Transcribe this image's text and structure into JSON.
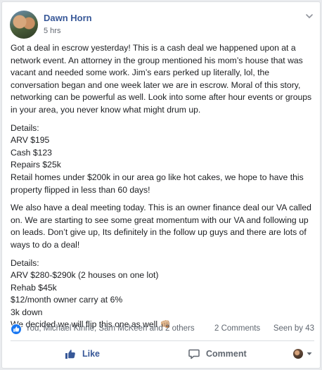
{
  "post": {
    "author": "Dawn Horn",
    "timestamp": "5 hrs",
    "options_icon": "chevron-down-icon",
    "body": {
      "p1": "Got a deal in escrow yesterday! This is a cash deal we happened upon at a network event. An attorney in the group mentioned his mom’s house that was vacant and needed some work. Jim’s ears perked up literally, lol, the conversation began and one week later we are in escrow. Moral of this story, networking can be powerful as well. Look into some after hour events or groups in your area, you never know what might drum up.",
      "d1_heading": "Details:",
      "d1_arv": "ARV $195",
      "d1_cash": "Cash $123",
      "d1_repairs": "Repairs $25k",
      "d1_note": "Retail homes under $200k in our area go like hot cakes, we hope to have this property flipped in less than 60 days!",
      "p2": "We also have a deal meeting today. This is an owner finance deal our VA called on. We are starting to see some great momentum with our VA and following up on leads. Don’t give up, Its definitely in the follow up guys and there are lots of ways to do a deal!",
      "d2_heading": "Details:",
      "d2_arv": "ARV $280-$290k (2 houses on one lot)",
      "d2_rehab": "Rehab $45k",
      "d2_carry": "$12/month owner carry at 6%",
      "d2_down": "3k down",
      "d2_closing": "We decided we will flip this one as well 👊🏼"
    }
  },
  "reactions": {
    "icon": "like-reaction-icon",
    "names": "You, Michael Kinne, Sam McKeen and 2 others",
    "comments": "2 Comments",
    "seen_by": "Seen by 43"
  },
  "actions": {
    "like_label": "Like",
    "comment_label": "Comment",
    "audience_icon": "chevron-down-icon"
  },
  "colors": {
    "brand_blue": "#385898",
    "like_blue": "#1877f2",
    "meta_gray": "#606770"
  }
}
